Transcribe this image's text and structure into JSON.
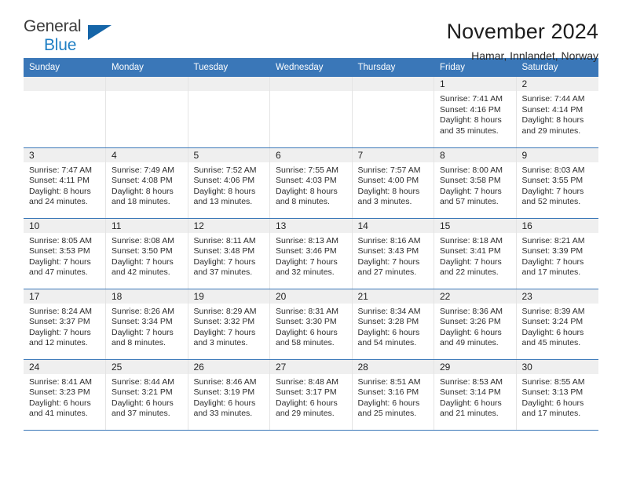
{
  "logo": {
    "primary_text": "General",
    "secondary_text": "Blue",
    "triangle_color": "#1565a8",
    "blue_color": "#1f7fc4"
  },
  "header": {
    "title": "November 2024",
    "subtitle": "Hamar, Innlandet, Norway"
  },
  "theme": {
    "header_bar_color": "#3a77b8",
    "day_band_color": "#efefef",
    "row_divider_color": "#3a77b8"
  },
  "calendar": {
    "weekday_headers": [
      "Sunday",
      "Monday",
      "Tuesday",
      "Wednesday",
      "Thursday",
      "Friday",
      "Saturday"
    ],
    "labels": {
      "sunrise_prefix": "Sunrise:",
      "sunset_prefix": "Sunset:",
      "daylight_prefix": "Daylight:"
    },
    "weeks": [
      [
        {
          "day": "",
          "empty": true
        },
        {
          "day": "",
          "empty": true
        },
        {
          "day": "",
          "empty": true
        },
        {
          "day": "",
          "empty": true
        },
        {
          "day": "",
          "empty": true
        },
        {
          "day": "1",
          "sunrise": "Sunrise: 7:41 AM",
          "sunset": "Sunset: 4:16 PM",
          "daylight": "Daylight: 8 hours and 35 minutes."
        },
        {
          "day": "2",
          "sunrise": "Sunrise: 7:44 AM",
          "sunset": "Sunset: 4:14 PM",
          "daylight": "Daylight: 8 hours and 29 minutes."
        }
      ],
      [
        {
          "day": "3",
          "sunrise": "Sunrise: 7:47 AM",
          "sunset": "Sunset: 4:11 PM",
          "daylight": "Daylight: 8 hours and 24 minutes."
        },
        {
          "day": "4",
          "sunrise": "Sunrise: 7:49 AM",
          "sunset": "Sunset: 4:08 PM",
          "daylight": "Daylight: 8 hours and 18 minutes."
        },
        {
          "day": "5",
          "sunrise": "Sunrise: 7:52 AM",
          "sunset": "Sunset: 4:06 PM",
          "daylight": "Daylight: 8 hours and 13 minutes."
        },
        {
          "day": "6",
          "sunrise": "Sunrise: 7:55 AM",
          "sunset": "Sunset: 4:03 PM",
          "daylight": "Daylight: 8 hours and 8 minutes."
        },
        {
          "day": "7",
          "sunrise": "Sunrise: 7:57 AM",
          "sunset": "Sunset: 4:00 PM",
          "daylight": "Daylight: 8 hours and 3 minutes."
        },
        {
          "day": "8",
          "sunrise": "Sunrise: 8:00 AM",
          "sunset": "Sunset: 3:58 PM",
          "daylight": "Daylight: 7 hours and 57 minutes."
        },
        {
          "day": "9",
          "sunrise": "Sunrise: 8:03 AM",
          "sunset": "Sunset: 3:55 PM",
          "daylight": "Daylight: 7 hours and 52 minutes."
        }
      ],
      [
        {
          "day": "10",
          "sunrise": "Sunrise: 8:05 AM",
          "sunset": "Sunset: 3:53 PM",
          "daylight": "Daylight: 7 hours and 47 minutes."
        },
        {
          "day": "11",
          "sunrise": "Sunrise: 8:08 AM",
          "sunset": "Sunset: 3:50 PM",
          "daylight": "Daylight: 7 hours and 42 minutes."
        },
        {
          "day": "12",
          "sunrise": "Sunrise: 8:11 AM",
          "sunset": "Sunset: 3:48 PM",
          "daylight": "Daylight: 7 hours and 37 minutes."
        },
        {
          "day": "13",
          "sunrise": "Sunrise: 8:13 AM",
          "sunset": "Sunset: 3:46 PM",
          "daylight": "Daylight: 7 hours and 32 minutes."
        },
        {
          "day": "14",
          "sunrise": "Sunrise: 8:16 AM",
          "sunset": "Sunset: 3:43 PM",
          "daylight": "Daylight: 7 hours and 27 minutes."
        },
        {
          "day": "15",
          "sunrise": "Sunrise: 8:18 AM",
          "sunset": "Sunset: 3:41 PM",
          "daylight": "Daylight: 7 hours and 22 minutes."
        },
        {
          "day": "16",
          "sunrise": "Sunrise: 8:21 AM",
          "sunset": "Sunset: 3:39 PM",
          "daylight": "Daylight: 7 hours and 17 minutes."
        }
      ],
      [
        {
          "day": "17",
          "sunrise": "Sunrise: 8:24 AM",
          "sunset": "Sunset: 3:37 PM",
          "daylight": "Daylight: 7 hours and 12 minutes."
        },
        {
          "day": "18",
          "sunrise": "Sunrise: 8:26 AM",
          "sunset": "Sunset: 3:34 PM",
          "daylight": "Daylight: 7 hours and 8 minutes."
        },
        {
          "day": "19",
          "sunrise": "Sunrise: 8:29 AM",
          "sunset": "Sunset: 3:32 PM",
          "daylight": "Daylight: 7 hours and 3 minutes."
        },
        {
          "day": "20",
          "sunrise": "Sunrise: 8:31 AM",
          "sunset": "Sunset: 3:30 PM",
          "daylight": "Daylight: 6 hours and 58 minutes."
        },
        {
          "day": "21",
          "sunrise": "Sunrise: 8:34 AM",
          "sunset": "Sunset: 3:28 PM",
          "daylight": "Daylight: 6 hours and 54 minutes."
        },
        {
          "day": "22",
          "sunrise": "Sunrise: 8:36 AM",
          "sunset": "Sunset: 3:26 PM",
          "daylight": "Daylight: 6 hours and 49 minutes."
        },
        {
          "day": "23",
          "sunrise": "Sunrise: 8:39 AM",
          "sunset": "Sunset: 3:24 PM",
          "daylight": "Daylight: 6 hours and 45 minutes."
        }
      ],
      [
        {
          "day": "24",
          "sunrise": "Sunrise: 8:41 AM",
          "sunset": "Sunset: 3:23 PM",
          "daylight": "Daylight: 6 hours and 41 minutes."
        },
        {
          "day": "25",
          "sunrise": "Sunrise: 8:44 AM",
          "sunset": "Sunset: 3:21 PM",
          "daylight": "Daylight: 6 hours and 37 minutes."
        },
        {
          "day": "26",
          "sunrise": "Sunrise: 8:46 AM",
          "sunset": "Sunset: 3:19 PM",
          "daylight": "Daylight: 6 hours and 33 minutes."
        },
        {
          "day": "27",
          "sunrise": "Sunrise: 8:48 AM",
          "sunset": "Sunset: 3:17 PM",
          "daylight": "Daylight: 6 hours and 29 minutes."
        },
        {
          "day": "28",
          "sunrise": "Sunrise: 8:51 AM",
          "sunset": "Sunset: 3:16 PM",
          "daylight": "Daylight: 6 hours and 25 minutes."
        },
        {
          "day": "29",
          "sunrise": "Sunrise: 8:53 AM",
          "sunset": "Sunset: 3:14 PM",
          "daylight": "Daylight: 6 hours and 21 minutes."
        },
        {
          "day": "30",
          "sunrise": "Sunrise: 8:55 AM",
          "sunset": "Sunset: 3:13 PM",
          "daylight": "Daylight: 6 hours and 17 minutes."
        }
      ]
    ]
  }
}
